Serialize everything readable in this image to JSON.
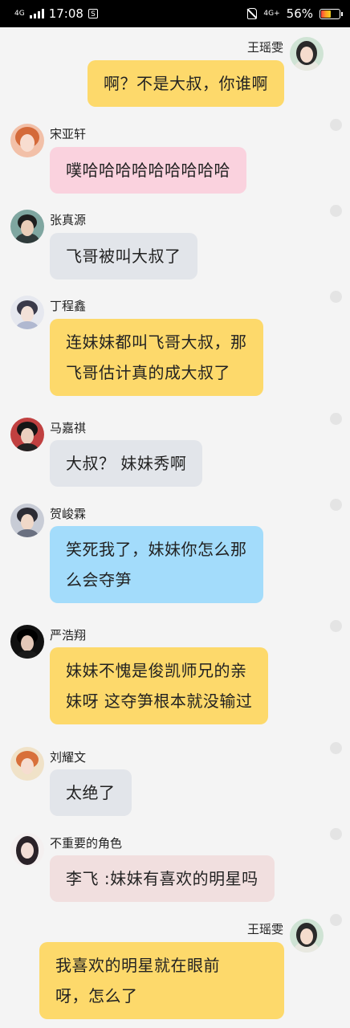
{
  "status_bar": {
    "network_left": "4G",
    "time": "17:08",
    "app_icon": "soul-icon",
    "network_right": "4G+",
    "battery": "56%",
    "battery_level": 0.56
  },
  "colors": {
    "yellow": "#fdd96b",
    "pink": "#fad2de",
    "gray": "#e2e5ea",
    "blue": "#a3dcfb",
    "rose": "#f1dfdf"
  },
  "messages": [
    {
      "name": "王瑶雯",
      "text": "啊？不是大叔，你谁啊",
      "side": "right",
      "color": "yellow"
    },
    {
      "name": "宋亚轩",
      "text": "噗哈哈哈哈哈哈哈哈哈",
      "side": "left",
      "color": "pink"
    },
    {
      "name": "张真源",
      "text": "飞哥被叫大叔了",
      "side": "left",
      "color": "gray"
    },
    {
      "name": "丁程鑫",
      "line1": "连妹妹都叫飞哥大叔，那",
      "line2": "飞哥估计真的成大叔了",
      "side": "left",
      "color": "yellow"
    },
    {
      "name": "马嘉祺",
      "text": "大叔？ 妹妹秀啊",
      "side": "left",
      "color": "gray"
    },
    {
      "name": "贺峻霖",
      "line1": "笑死我了，妹妹你怎么那",
      "line2": "么会夺笋",
      "side": "left",
      "color": "blue"
    },
    {
      "name": "严浩翔",
      "line1": "妹妹不愧是俊凯师兄的亲",
      "line2": "妹呀 这夺笋根本就没输过",
      "side": "left",
      "color": "yellow"
    },
    {
      "name": "刘耀文",
      "text": "太绝了",
      "side": "left",
      "color": "gray"
    },
    {
      "name": "不重要的角色",
      "text": "李飞 :妹妹有喜欢的明星吗",
      "side": "left",
      "color": "rose"
    },
    {
      "name": "王瑶雯",
      "line1": "我喜欢的明星就在眼前",
      "line2": "呀，怎么了",
      "side": "right",
      "color": "yellow"
    }
  ]
}
